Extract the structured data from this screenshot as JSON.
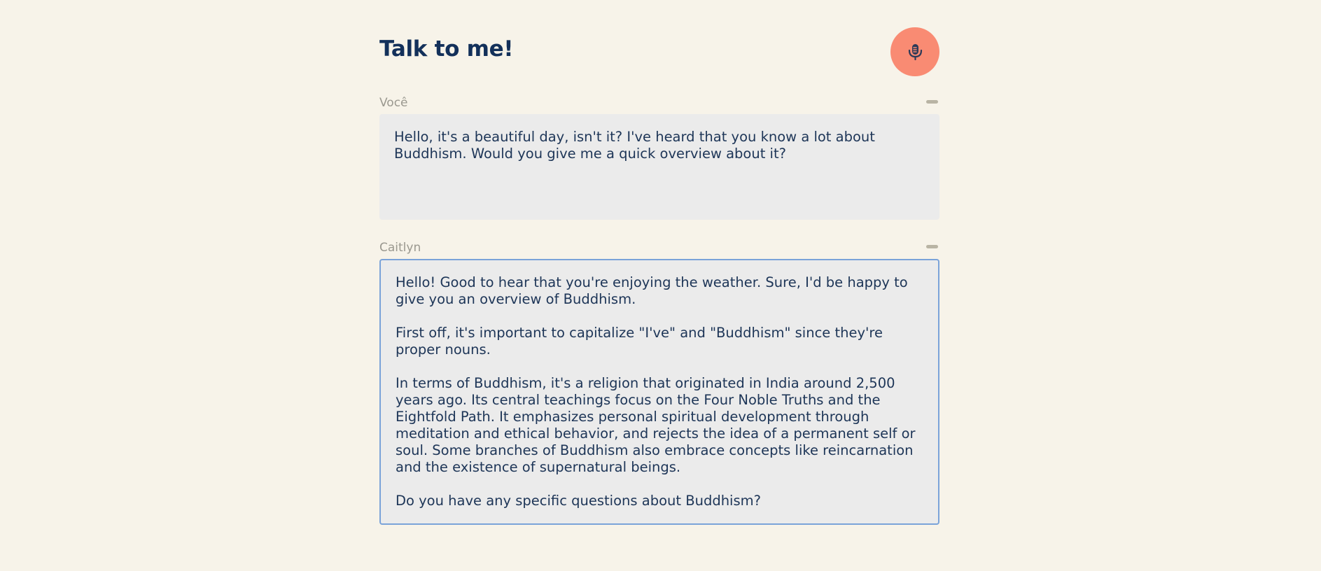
{
  "header": {
    "title": "Talk to me!",
    "mic_icon": "microphone-icon",
    "mic_color": "#f98b73"
  },
  "conversation": {
    "user": {
      "label": "Você",
      "message": "Hello, it's a beautiful day, isn't it? I've heard that you know a lot about Buddhism. Would you give me a quick overview about it?"
    },
    "assistant": {
      "label": "Caitlyn",
      "message": "Hello! Good to hear that you're enjoying the weather. Sure, I'd be happy to give you an overview of Buddhism.\n\nFirst off, it's important to capitalize \"I've\" and \"Buddhism\" since they're proper nouns.\n\nIn terms of Buddhism, it's a religion that originated in India around 2,500 years ago. Its central teachings focus on the Four Noble Truths and the Eightfold Path. It emphasizes personal spiritual development through meditation and ethical behavior, and rejects the idea of a permanent self or soul. Some branches of Buddhism also embrace concepts like reincarnation and the existence of supernatural beings.\n\nDo you have any specific questions about Buddhism?"
    }
  },
  "colors": {
    "background": "#f7f3e9",
    "title": "#13305a",
    "accent_border": "#7aa3d9",
    "message_bg": "#ebebeb"
  }
}
